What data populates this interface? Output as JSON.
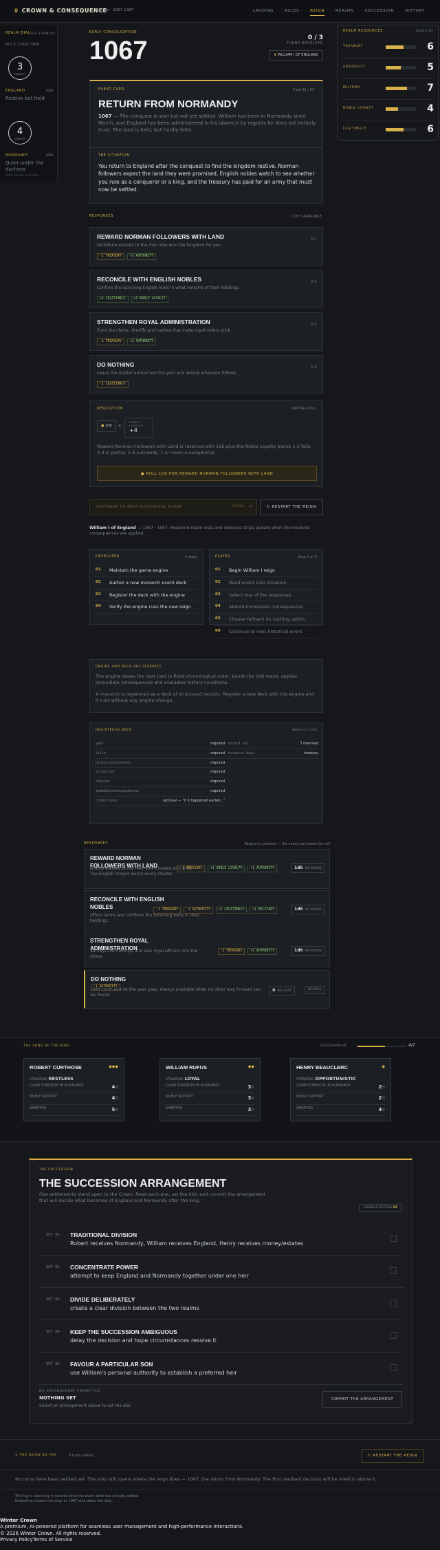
{
  "header": {
    "brand": "CROWN & CONSEQUENCE",
    "crumb": "A Reign · 1067 1087",
    "nav": [
      "LANDING",
      "RULES",
      "REIGN",
      "REALMS",
      "SUCCESSION",
      "HISTORY"
    ]
  },
  "left": {
    "title": "REALM DIAL",
    "title2": "SEE SUMMARY",
    "sub": "RULE TOGETHER",
    "england_n": "3",
    "england_stab": "STABILITY",
    "england": "ENGLAND",
    "england_val": "1066",
    "england_mood": "Restive but held",
    "normandy_n": "4",
    "normandy_stab": "STABILITY",
    "normandy": "NORMANDY",
    "normandy_val": "1066",
    "normandy_mood": "Quiet under the duchess",
    "foot": "Both beside on stable"
  },
  "era": {
    "label": "EARLY CONSOLIDATION",
    "year": "1067",
    "turns": "0 / 3",
    "turns_label": "TURNS RESOLVED",
    "king": "WILLIAM I OF ENGLAND"
  },
  "resources": {
    "title": "REALM RESOURCES",
    "scale": "Scale 0-10",
    "items": [
      {
        "name": "TREASURY",
        "value": "6",
        "pct": 0.6
      },
      {
        "name": "AUTHORITY",
        "value": "5",
        "pct": 0.5
      },
      {
        "name": "MILITARY",
        "value": "7",
        "pct": 0.7
      },
      {
        "name": "NOBLE LOYALTY",
        "value": "4",
        "pct": 0.4
      },
      {
        "name": "LEGITIMACY",
        "value": "6",
        "pct": 0.6
      }
    ]
  },
  "event": {
    "label": "EVENT CARD",
    "card": "Card 01 / 03",
    "title": "RETURN FROM NORMANDY",
    "year": "1067",
    "desc": " — The conquest is won but not yet settled. William has been in Normandy since March, and England has been administered in his absence by regents he does not entirely trust. The land is held, but hardly held.",
    "sit_label": "THE SITUATION",
    "situation": "You return to England after the conquest to find the kingdom restive. Norman followers expect the land they were promised, English nobles watch to see whether you rule as a conqueror or a king, and the treasury has paid for an army that must now be settled."
  },
  "responses": {
    "label": "RESPONSES",
    "count": "1 OF 3 AVAILABLE",
    "items": [
      {
        "title": "REWARD NORMAN FOLLOWERS WITH LAND",
        "desc": "Distribute estates to the men who won the kingdom for you.",
        "id": "R-1",
        "tags": [
          "-2 TREASURY",
          "+1 AUTHORITY"
        ]
      },
      {
        "title": "RECONCILE WITH ENGLISH NOBLES",
        "desc": "Confirm the surviving English lords in what remains of their holdings.",
        "id": "R-2",
        "tags": [
          "+1 LEGITIMACY",
          "+1 NOBLE LOYALTY"
        ]
      },
      {
        "title": "STRENGTHEN ROYAL ADMINISTRATION",
        "desc": "Fund the clerks, sheriffs and castles that make royal orders stick.",
        "id": "R-3",
        "tags": [
          "-1 TREASURY",
          "+2 AUTHORITY"
        ]
      },
      {
        "title": "DO NOTHING",
        "desc": "Leave the matter untouched this year and absorb whatever follows.",
        "id": "R-0",
        "tags": [
          "-1 LEGITIMACY"
        ]
      }
    ]
  },
  "resolution": {
    "label": "RESOLUTION",
    "status": "AWAITING ROLL",
    "die": "1d6",
    "bonus_label": "NOBLE LOYALTY",
    "bonus": "+4",
    "text": "Reward Norman Followers with Land is resolved with 1d6 plus the Noble Loyalty bonus 1-2 fails, 3-4 is partial, 5-6 succeeds, 7 or more is exceptional.",
    "roll_btn": "ROLL 1D6 FOR REWARD NORMAN FOLLOWERS WITH LAND"
  },
  "actions": {
    "continue": "CONTINUE TO NEXT HISTORICAL EVENT",
    "locked": "LOCKED",
    "restart": "RESTART THE REIGN"
  },
  "status": {
    "king": "William I of England",
    "text": " — 1067 · 1067. Reserved realm dials and resource strips update when the resolved consequences are applied."
  },
  "developer": {
    "title": "DEVELOPER",
    "count": "4 steps",
    "steps": [
      "Maintain the game engine",
      "Author a new monarch event deck",
      "Register the deck with the engine",
      "Verify the engine runs the new reign"
    ]
  },
  "player": {
    "title": "PLAYER",
    "count": "Step 1 of 6",
    "steps": [
      "Begin William I reign",
      "Read event card situation",
      "Select one of the responses",
      "Absorb immediate consequences",
      "Choose fallback do nothing option",
      "Continue to next historical event"
    ]
  },
  "engine": {
    "title": "ENGINE AND DECK ARE SEPARATE",
    "p1": "The engine draws the next card in fixed chronological order, bands the 1d6 result, applies immediate consequences and evaluates history conditions.",
    "p2": "A monarch is registered as a deck of structured records. Register a new deck with the engine and it runs without any engine change."
  },
  "deck": {
    "title": "REGISTERED DECK",
    "sub": "william-i 3 cards",
    "rows": [
      [
        "year",
        "required"
      ],
      [
        "title",
        "required"
      ],
      [
        "historicalContext",
        "required"
      ],
      [
        "situation",
        "required"
      ],
      [
        "choices",
        "required"
      ],
      [
        "immediateConsequences",
        "required"
      ],
      [
        "conditional",
        "optional — \"if X happened earlier...\""
      ]
    ],
    "rows2": [
      [
        "record ids",
        "7 reserved"
      ],
      [
        "resource keys",
        "treasury"
      ]
    ]
  },
  "preview": {
    "label": "RESPONSES",
    "note": "Read only preview — the event card owns the roll",
    "items": [
      {
        "title": "REWARD NORMAN FOLLOWERS WITH LAND",
        "desc": "Grants estates to the men who crossed with you. The English thegns watch every charter.",
        "tags": [
          "-2 TREASURY",
          "+1 NOBLE LOYALTY",
          "+1 AUTHORITY"
        ],
        "roll": "1d6",
        "rlabel": "NO BONUS"
      },
      {
        "title": "RECONCILE WITH ENGLISH NOBLES",
        "desc": "Offers terms and confirms the surviving earls in their holdings.",
        "tags": [
          "-1 TREASURY",
          "-1 AUTHORITY",
          "+1 LEGITIMACY",
          "+1 MILITARY"
        ],
        "roll": "1d6",
        "rlabel": "NO BONUS"
      },
      {
        "title": "STRENGTHEN ROYAL ADMINISTRATION",
        "desc": "Surveys the holdings and sets royal officers into the shires.",
        "tags": [
          "-1 TREASURY",
          "+1 AUTHORITY"
        ],
        "roll": "1d6",
        "rlabel": "NO BONUS"
      },
      {
        "title": "DO NOTHING",
        "desc": "Hold court and let the year pass. Always available when no other way forward can be found.",
        "tags": [
          "-1 AUTHORITY"
        ],
        "roll": "0",
        "rlabel": "NO COST",
        "extra": "NO ROLL"
      }
    ]
  },
  "sons": {
    "label": "THE SONS OF THE KING",
    "meter_label": "SUCCESSION AIR",
    "meter": "4/7",
    "items": [
      {
        "name": "ROBERT CURTHOSE",
        "stars": "◆◆◆",
        "standing": "RESTLESS",
        "claim": "4",
        "noble": "4",
        "ambition": "5"
      },
      {
        "name": "WILLIAM RUFUS",
        "stars": "◆◆",
        "standing": "LOYAL",
        "claim": "3",
        "noble": "3",
        "ambition": "3"
      },
      {
        "name": "HENRY BEAUCLERC",
        "stars": "◆",
        "standing": "OPPORTUNISTIC",
        "claim": "2",
        "noble": "2",
        "ambition": "4"
      }
    ],
    "standing_label": "STANDING",
    "claim_label": "CLAIM STRENGTH IN NORMANDY",
    "noble_label": "NOBLE SUPPORT",
    "amb_label": "AMBITION",
    "max": "/5"
  },
  "succession": {
    "label": "THE SUCCESSION",
    "title": "THE SUCCESSION ARRANGEMENT",
    "desc": "Five settlements stand open to the Crown. Read each one, set the dial, and commit the arrangement that will decide what becomes of England and Normandy after the king.",
    "badge_label": "ENDINGS SETTING",
    "badge": "05",
    "items": [
      {
        "k": "SET 01",
        "h": "TRADITIONAL DIVISION",
        "d": "Robert receives Normandy, William receives England, Henry receives money/estates"
      },
      {
        "k": "SET 02",
        "h": "CONCENTRATE POWER",
        "d": "attempt to keep England and Normandy together under one heir"
      },
      {
        "k": "SET 03",
        "h": "DIVIDE DELIBERATELY",
        "d": "create a clear division between the two realms"
      },
      {
        "k": "SET 04",
        "h": "KEEP THE SUCCESSION AMBIGUOUS",
        "d": "delay the decision and hope circumstances resolve it"
      },
      {
        "k": "SET 05",
        "h": "FAVOUR A PARTICULAR SON",
        "d": "use William's personal authority to establish a preferred heir"
      }
    ],
    "none_label": "NO ARRANGEMENT COMMITTED",
    "none": "NOTHING SET",
    "none_hint": "Select an arrangement above to set the dial.",
    "commit": "COMMIT THE ARRANGEMENT"
  },
  "history": {
    "label": "THE REIGN SO FAR",
    "count": "0 turns settled",
    "restart": "RESTART THE REIGN",
    "text": "No turns have been settled yet. The strip still opens where the reign does — 1067, the return from Normandy. The first resolved decision will be ruled in above it.",
    "note": "This log is read-only. It records what the event deck has already settled. Restarting returns the reign to 1067 and clears the strip."
  },
  "footer": {
    "name": "Winter Crown",
    "tagline": "A premium, AI-powered platform for seamless user management and high-performance interactions.",
    "copy": "© 2026 Winter Crown. All rights reserved.",
    "privacy": "Privacy Policy",
    "terms": "Terms of Service"
  },
  "colors": {
    "accent": "#d9b24a",
    "bg": "#15171b",
    "positive": "#8ecf7a"
  }
}
